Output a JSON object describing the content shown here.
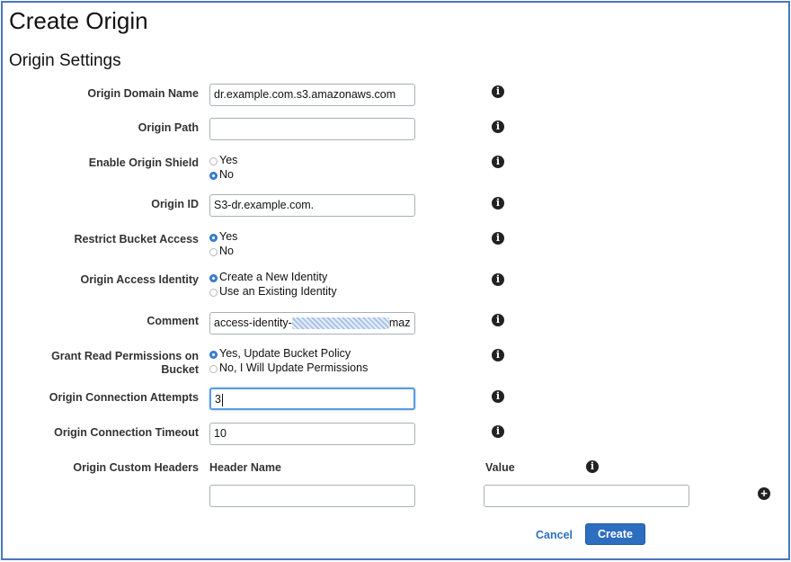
{
  "page": {
    "title": "Create Origin",
    "section": "Origin Settings"
  },
  "fields": {
    "origin_domain_name": {
      "label": "Origin Domain Name",
      "value": "dr.example.com.s3.amazonaws.com"
    },
    "origin_path": {
      "label": "Origin Path",
      "value": ""
    },
    "enable_origin_shield": {
      "label": "Enable Origin Shield",
      "options": [
        "Yes",
        "No"
      ],
      "selected": "No"
    },
    "origin_id": {
      "label": "Origin ID",
      "value": "S3-dr.example.com."
    },
    "restrict_bucket_access": {
      "label": "Restrict Bucket Access",
      "options": [
        "Yes",
        "No"
      ],
      "selected": "Yes"
    },
    "origin_access_identity": {
      "label": "Origin Access Identity",
      "options": [
        "Create a New Identity",
        "Use an Existing Identity"
      ],
      "selected": "Create a New Identity"
    },
    "comment": {
      "label": "Comment",
      "value_prefix": "access-identity-",
      "value_suffix": "maz"
    },
    "grant_read_permissions": {
      "label_line1": "Grant Read Permissions on",
      "label_line2": "Bucket",
      "options": [
        "Yes, Update Bucket Policy",
        "No, I Will Update Permissions"
      ],
      "selected": "Yes, Update Bucket Policy"
    },
    "origin_connection_attempts": {
      "label": "Origin Connection Attempts",
      "value": "3"
    },
    "origin_connection_timeout": {
      "label": "Origin Connection Timeout",
      "value": "10"
    },
    "origin_custom_headers": {
      "label": "Origin Custom Headers",
      "header_name_label": "Header Name",
      "value_label": "Value",
      "header_name": "",
      "value": ""
    }
  },
  "actions": {
    "cancel_label": "Cancel",
    "create_label": "Create"
  },
  "icons": {
    "info": "info-icon",
    "add": "plus-circle-icon"
  },
  "colors": {
    "accent": "#2d6ec0",
    "link": "#2f6fbf",
    "frame": "#4a76c0"
  }
}
